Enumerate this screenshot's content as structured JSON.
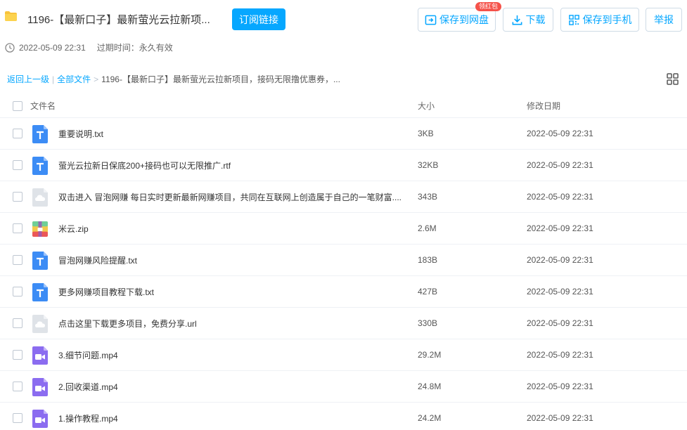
{
  "header": {
    "title": "1196-【最新口子】最新萤光云拉新项...",
    "subscribe_label": "订阅链接",
    "actions": {
      "save_to_disk": "保存到网盘",
      "red_packet_badge": "领红包",
      "download": "下载",
      "save_to_phone": "保存到手机",
      "report": "举报"
    },
    "share_time": "2022-05-09 22:31",
    "expire_label": "过期时间：永久有效"
  },
  "breadcrumb": {
    "back": "返回上一级",
    "all_files": "全部文件",
    "current": "1196-【最新口子】最新萤光云拉新项目，接码无限撸优惠券，..."
  },
  "table": {
    "headers": {
      "name": "文件名",
      "size": "大小",
      "date": "修改日期"
    },
    "rows": [
      {
        "icon": "txt-icon",
        "name": "重要说明.txt",
        "size": "3KB",
        "date": "2022-05-09 22:31"
      },
      {
        "icon": "txt-icon",
        "name": "萤光云拉新日保底200+接码也可以无限推广.rtf",
        "size": "32KB",
        "date": "2022-05-09 22:31"
      },
      {
        "icon": "cloud-file-icon",
        "name": "双击进入 冒泡网赚 每日实时更新最新网赚项目，共同在互联网上创造属于自己的一笔财富....",
        "size": "343B",
        "date": "2022-05-09 22:31"
      },
      {
        "icon": "zip-icon",
        "name": "米云.zip",
        "size": "2.6M",
        "date": "2022-05-09 22:31"
      },
      {
        "icon": "txt-icon",
        "name": "冒泡网赚风险提醒.txt",
        "size": "183B",
        "date": "2022-05-09 22:31"
      },
      {
        "icon": "txt-icon",
        "name": "更多网赚项目教程下载.txt",
        "size": "427B",
        "date": "2022-05-09 22:31"
      },
      {
        "icon": "cloud-file-icon",
        "name": "点击这里下载更多项目，免费分享.url",
        "size": "330B",
        "date": "2022-05-09 22:31"
      },
      {
        "icon": "video-icon",
        "name": "3.细节问题.mp4",
        "size": "29.2M",
        "date": "2022-05-09 22:31"
      },
      {
        "icon": "video-icon",
        "name": "2.回收渠道.mp4",
        "size": "24.8M",
        "date": "2022-05-09 22:31"
      },
      {
        "icon": "video-icon",
        "name": "1.操作教程.mp4",
        "size": "24.2M",
        "date": "2022-05-09 22:31"
      }
    ]
  },
  "colors": {
    "accent": "#06a7ff",
    "badge_red": "#f5524a",
    "txt_icon": "#3c8cf5",
    "video_icon": "#8b6cf0",
    "cloud_icon": "#dfe3e8"
  }
}
